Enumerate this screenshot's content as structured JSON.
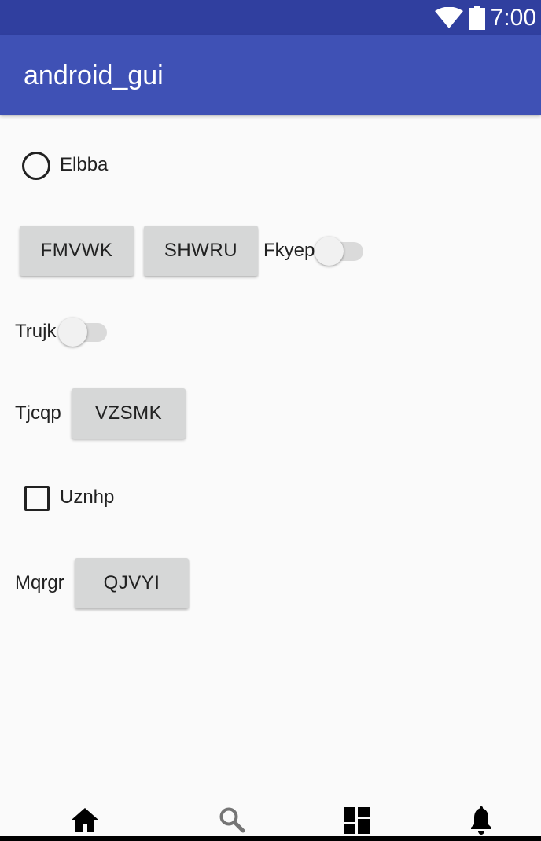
{
  "status_bar": {
    "time": "7:00",
    "wifi_icon": "wifi-icon",
    "battery_icon": "battery-icon",
    "background": "#303f9f"
  },
  "app_bar": {
    "title": "android_gui",
    "background": "#3f51b5"
  },
  "radio": {
    "label": "Elbba",
    "checked": false
  },
  "row1": {
    "button1_label": "FMVWK",
    "button2_label": "SHWRU",
    "switch_label": "Fkyep",
    "switch_on": false
  },
  "row2": {
    "switch_label": "Trujk",
    "switch_on": false
  },
  "row3": {
    "label": "Tjcqp",
    "button_label": "VZSMK"
  },
  "checkbox": {
    "label": "Uznhp",
    "checked": false
  },
  "row4": {
    "label": "Mqrgr",
    "button_label": "QJVYI"
  },
  "bottom_nav": {
    "items": [
      "home-icon",
      "search-icon",
      "dashboard-icon",
      "notifications-icon"
    ]
  }
}
